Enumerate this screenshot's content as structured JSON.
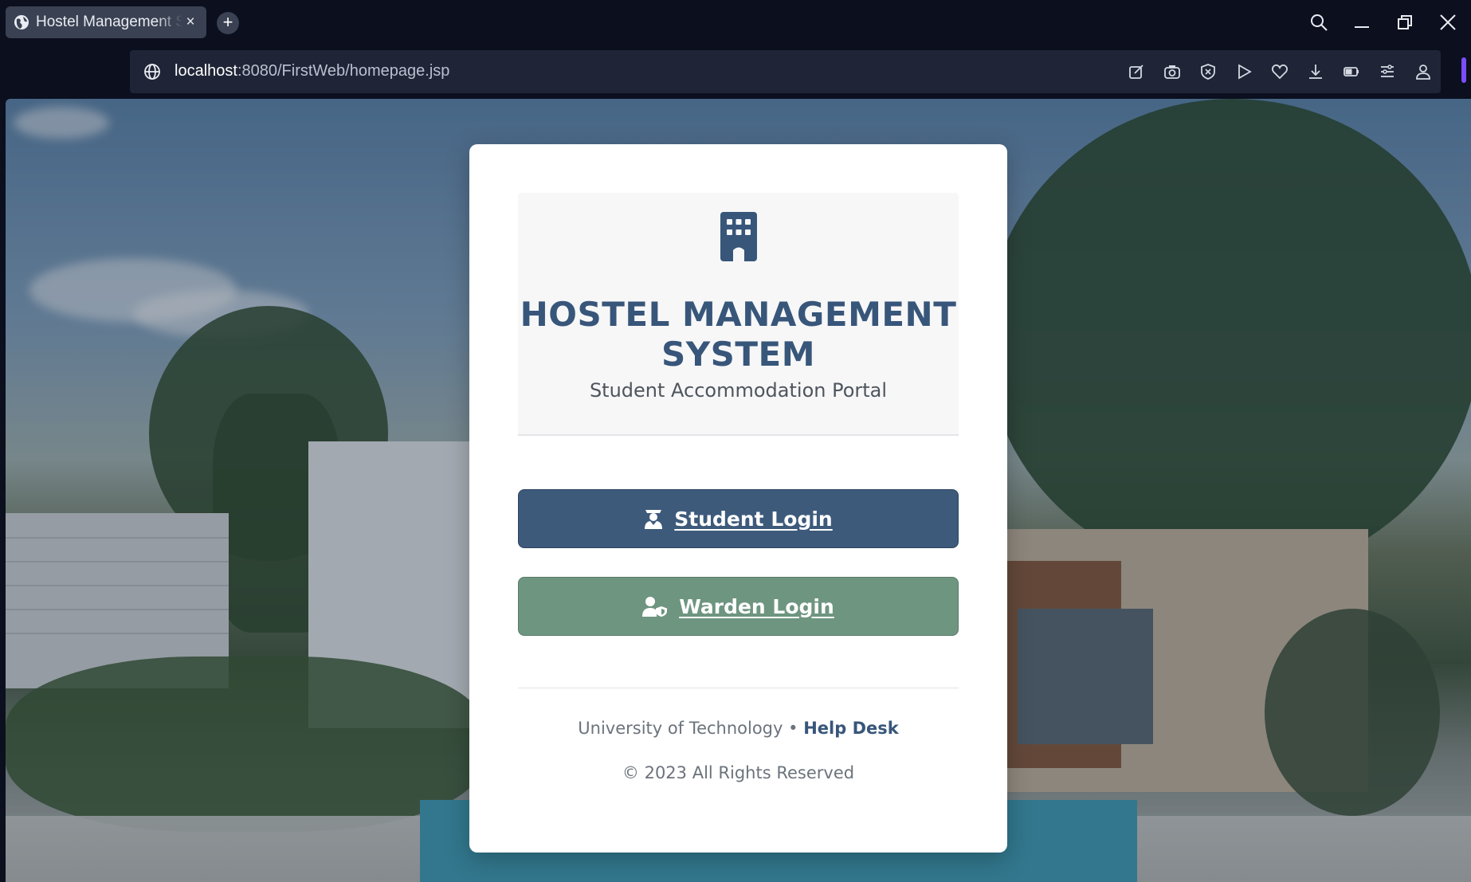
{
  "browser": {
    "tab_title": "Hostel Management System",
    "new_tab_symbol": "+",
    "close_symbol": "×",
    "url_host": "localhost",
    "url_rest": ":8080/FirstWeb/homepage.jsp",
    "toolbar_icons": [
      "edit-icon",
      "camera-icon",
      "shield-icon",
      "play-icon",
      "heart-icon",
      "download-icon",
      "battery-icon",
      "settings-icon",
      "profile-icon"
    ],
    "accent": "#7c4dff"
  },
  "card": {
    "title": "HOSTEL MANAGEMENT SYSTEM",
    "subtitle": "Student Accommodation Portal",
    "student_login": "Student Login",
    "warden_login": "Warden Login",
    "footer_org": "University of Technology",
    "footer_sep": " • ",
    "footer_help": "Help Desk",
    "copyright": "© 2023 All Rights Reserved",
    "colors": {
      "primary": "#38567a",
      "student_button": "#3d5a7b",
      "warden_button": "#6e9580"
    }
  }
}
